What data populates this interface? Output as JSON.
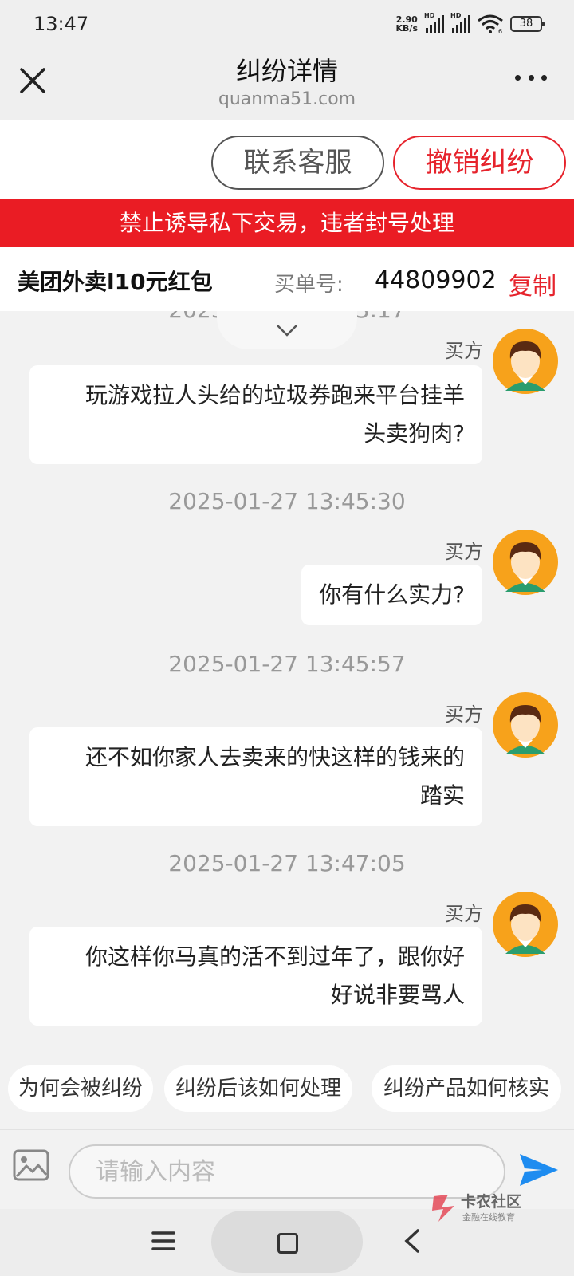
{
  "status_bar": {
    "time": "13:47",
    "net_speed_value": "2.90",
    "net_speed_unit": "KB/s",
    "signal_1_label": "HD",
    "signal_2_label": "HD",
    "wifi_label": "6",
    "battery": "38"
  },
  "header": {
    "title": "纠纷详情",
    "domain": "quanma51.com"
  },
  "actions": {
    "contact_label": "联系客服",
    "revoke_label": "撤销纠纷"
  },
  "warning": "禁止诱导私下交易，违者封号处理",
  "order": {
    "product": "美团外卖l10元红包",
    "label": "买单号:",
    "number": "44809902",
    "copy_label": "复制"
  },
  "chat": {
    "partial_timestamp": "2025-01-27 13:43:17",
    "messages": [
      {
        "sender": "买方",
        "line1": "玩游戏拉人头给的垃圾券跑来平台挂羊",
        "line2": "头卖狗肉?"
      },
      {
        "timestamp": "2025-01-27 13:45:30",
        "sender": "买方",
        "line1": "你有什么实力?",
        "line2": ""
      },
      {
        "timestamp": "2025-01-27 13:45:57",
        "sender": "买方",
        "line1": "还不如你家人去卖来的快这样的钱来的",
        "line2": "踏实"
      },
      {
        "timestamp": "2025-01-27 13:47:05",
        "sender": "买方",
        "line1": "你这样你马真的活不到过年了，跟你好",
        "line2": "好说非要骂人"
      }
    ]
  },
  "quick_replies": [
    "为何会被纠纷",
    "纠纷后该如何处理",
    "纠纷产品如何核实"
  ],
  "input": {
    "placeholder": "请输入内容"
  },
  "watermark": {
    "text": "卡农社区",
    "sub": "金融在线教育"
  },
  "colors": {
    "accent_red": "#ea1c24",
    "send_blue": "#1e8cf0",
    "avatar_orange": "#f7a21b"
  }
}
